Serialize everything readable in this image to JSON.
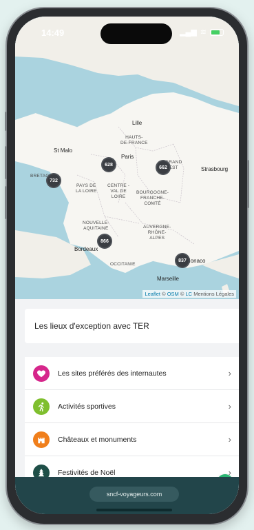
{
  "status_bar": {
    "time": "14:49",
    "signal": "▂▄▆",
    "wifi": "≋"
  },
  "map": {
    "regions": [
      {
        "id": "hauts",
        "label": "HAUTS-\nDE-FRANCE"
      },
      {
        "id": "grandest",
        "label": "GRAND\nEST"
      },
      {
        "id": "bretagne",
        "label": "BRETAGNE"
      },
      {
        "id": "pdl",
        "label": "PAYS DE\nLA LOIRE"
      },
      {
        "id": "cvl",
        "label": "CENTRE -\nVAL DE\nLOIRE"
      },
      {
        "id": "bfc",
        "label": "BOURGOGNE-\nFRANCHE-\nCOMTÉ"
      },
      {
        "id": "na",
        "label": "NOUVELLE-\nAQUITAINE"
      },
      {
        "id": "ara",
        "label": "AUVERGNE-\nRHÔNE-\nALPES"
      },
      {
        "id": "occ",
        "label": "OCCITANIE"
      }
    ],
    "cities": [
      {
        "id": "lille",
        "name": "Lille"
      },
      {
        "id": "paris",
        "name": "Paris"
      },
      {
        "id": "stmalo",
        "name": "St Malo"
      },
      {
        "id": "strasbourg",
        "name": "Strasbourg"
      },
      {
        "id": "bordeaux",
        "name": "Bordeaux"
      },
      {
        "id": "marseille",
        "name": "Marseille"
      },
      {
        "id": "monaco",
        "name": "Monaco"
      }
    ],
    "clusters": [
      {
        "id": "paris",
        "count": "628"
      },
      {
        "id": "east",
        "count": "662"
      },
      {
        "id": "bretagne",
        "count": "732"
      },
      {
        "id": "aquitaine",
        "count": "866"
      },
      {
        "id": "paca",
        "count": "837"
      }
    ],
    "attribution": {
      "leaflet": "Leaflet",
      "sep": "©",
      "osm": "OSM",
      "lc": "LC",
      "legal": "Mentions Légales"
    }
  },
  "panel": {
    "title": "Les lieux d'exception avec TER",
    "items": [
      {
        "label": "Les sites préférés des internautes",
        "icon": "heart-icon",
        "color": "#d6268b"
      },
      {
        "label": "Activités sportives",
        "icon": "running-icon",
        "color": "#7fbf2e"
      },
      {
        "label": "Châteaux et monuments",
        "icon": "castle-icon",
        "color": "#f07f1c"
      },
      {
        "label": "Festivités de Noël",
        "icon": "christmas-tree-icon",
        "color": "#1f4f48"
      }
    ]
  },
  "scroll_top_icon": "↑",
  "browser": {
    "url": "sncf-voyageurs.com"
  },
  "colors": {
    "accent": "#2bb673",
    "bottom_bar": "#22454a",
    "cluster": "#3a3d42"
  }
}
